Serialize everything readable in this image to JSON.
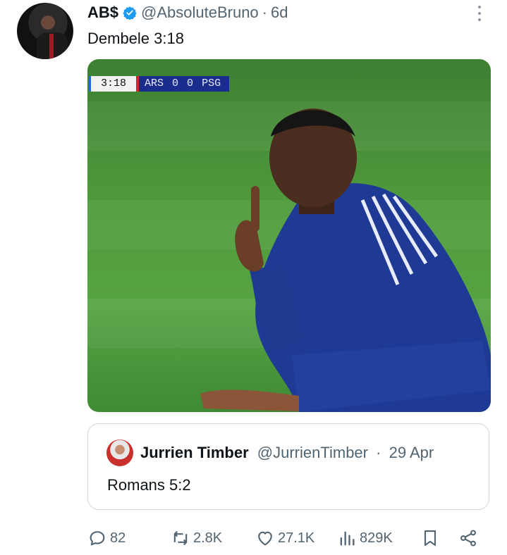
{
  "author": {
    "name": "AB$",
    "handle": "@AbsoluteBruno",
    "separator": "·",
    "time": "6d",
    "avatar_icon": "avatar"
  },
  "tweet": {
    "text": "Dembele 3:18"
  },
  "media": {
    "scoreboard": {
      "clock": "3:18",
      "home": "ARS",
      "home_score": "0",
      "away_score": "0",
      "away": "PSG"
    }
  },
  "quoted_tweet": {
    "name": "Jurrien Timber",
    "handle": "@JurrienTimber",
    "separator": "·",
    "time": "29 Apr",
    "text": "Romans 5:2"
  },
  "actions": {
    "replies": "82",
    "retweets": "2.8K",
    "likes": "27.1K",
    "views": "829K"
  },
  "colors": {
    "accent": "#1d9bf0",
    "secondary_text": "#536471",
    "border": "#cfd9de"
  }
}
